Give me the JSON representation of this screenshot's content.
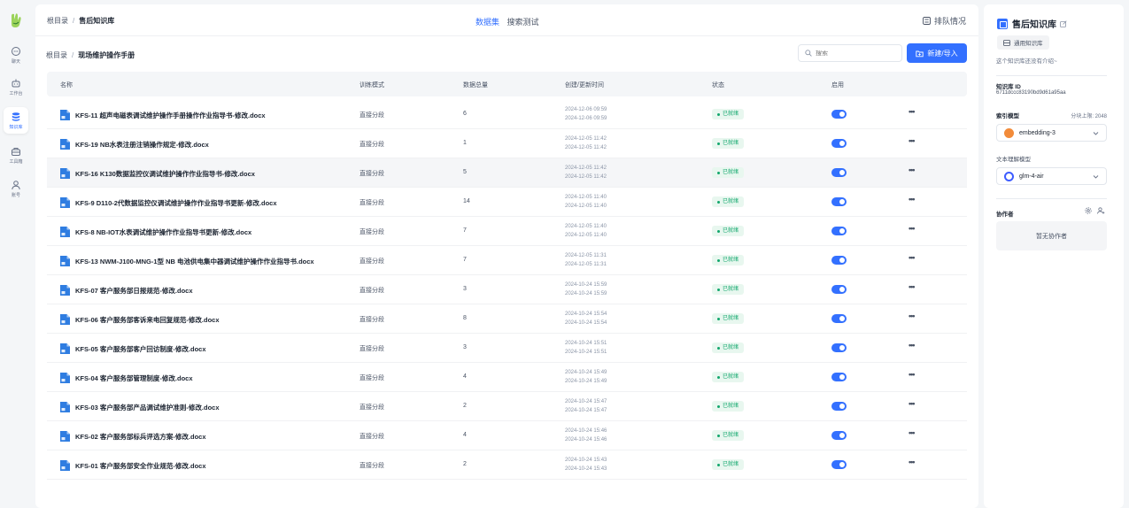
{
  "nav": {
    "items": [
      {
        "label": "聊天",
        "icon": "chat-icon"
      },
      {
        "label": "工作台",
        "icon": "robot-icon"
      },
      {
        "label": "知识库",
        "icon": "database-icon"
      },
      {
        "label": "工具箱",
        "icon": "toolbox-icon"
      },
      {
        "label": "账号",
        "icon": "user-icon"
      }
    ]
  },
  "header": {
    "breadcrumb_root": "根目录",
    "breadcrumb_current": "售后知识库",
    "tabs": [
      "数据集",
      "搜索测试"
    ],
    "queue_label": "排队情况"
  },
  "toolbar": {
    "breadcrumb_root": "根目录",
    "breadcrumb_current": "现场维护操作手册",
    "search_placeholder": "搜索",
    "new_button_label": "新建/导入"
  },
  "table": {
    "columns": [
      "名称",
      "训练模式",
      "数据总量",
      "创建/更新时间",
      "状态",
      "启用"
    ],
    "rows": [
      {
        "name": "KFS-11 超声电磁表调试维护操作手册操作作业指导书-修改.docx",
        "mode": "直接分段",
        "total": "6",
        "created": "2024-12-06 09:59",
        "updated": "2024-12-06 09:59",
        "status": "已就绪"
      },
      {
        "name": "KFS-19 NB水表注册注销操作规定-修改.docx",
        "mode": "直接分段",
        "total": "1",
        "created": "2024-12-05 11:42",
        "updated": "2024-12-05 11:42",
        "status": "已就绪"
      },
      {
        "name": "KFS-16 K130数据监控仪调试维护操作作业指导书-修改.docx",
        "mode": "直接分段",
        "total": "5",
        "created": "2024-12-05 11:42",
        "updated": "2024-12-05 11:42",
        "status": "已就绪"
      },
      {
        "name": "KFS-9 D110-2代数据监控仪调试维护操作作业指导书更新-修改.docx",
        "mode": "直接分段",
        "total": "14",
        "created": "2024-12-05 11:40",
        "updated": "2024-12-05 11:40",
        "status": "已就绪"
      },
      {
        "name": "KFS-8 NB-IOT水表调试维护操作作业指导书更新-修改.docx",
        "mode": "直接分段",
        "total": "7",
        "created": "2024-12-05 11:40",
        "updated": "2024-12-05 11:40",
        "status": "已就绪"
      },
      {
        "name": "KFS-13 NWM-J100-MNG-1型 NB 电池供电集中器调试维护操作作业指导书.docx",
        "mode": "直接分段",
        "total": "7",
        "created": "2024-12-05 11:31",
        "updated": "2024-12-05 11:31",
        "status": "已就绪"
      },
      {
        "name": "KFS-07 客户服务部日报规范-修改.docx",
        "mode": "直接分段",
        "total": "3",
        "created": "2024-10-24 15:59",
        "updated": "2024-10-24 15:59",
        "status": "已就绪"
      },
      {
        "name": "KFS-06 客户服务部客诉来电回复规范-修改.docx",
        "mode": "直接分段",
        "total": "8",
        "created": "2024-10-24 15:54",
        "updated": "2024-10-24 15:54",
        "status": "已就绪"
      },
      {
        "name": "KFS-05 客户服务部客户回访制度-修改.docx",
        "mode": "直接分段",
        "total": "3",
        "created": "2024-10-24 15:51",
        "updated": "2024-10-24 15:51",
        "status": "已就绪"
      },
      {
        "name": "KFS-04 客户服务部管理制度-修改.docx",
        "mode": "直接分段",
        "total": "4",
        "created": "2024-10-24 15:49",
        "updated": "2024-10-24 15:49",
        "status": "已就绪"
      },
      {
        "name": "KFS-03 客户服务部产品调试维护准则-修改.docx",
        "mode": "直接分段",
        "total": "2",
        "created": "2024-10-24 15:47",
        "updated": "2024-10-24 15:47",
        "status": "已就绪"
      },
      {
        "name": "KFS-02 客户服务部标兵评选方案-修改.docx",
        "mode": "直接分段",
        "total": "4",
        "created": "2024-10-24 15:46",
        "updated": "2024-10-24 15:46",
        "status": "已就绪"
      },
      {
        "name": "KFS-01 客户服务部安全作业规范-修改.docx",
        "mode": "直接分段",
        "total": "2",
        "created": "2024-10-24 15:43",
        "updated": "2024-10-24 15:43",
        "status": "已就绪"
      }
    ]
  },
  "side": {
    "title": "售后知识库",
    "type_chip": "通用知识库",
    "intro": "这个知识库还没有介绍~",
    "kb_id_label": "知识库 ID",
    "kb_id_value": "6711dccc83190bd9d61a95aa",
    "index_model_label": "索引模型",
    "chunk_limit": "分块上限: 2048",
    "index_model_value": "embedding-3",
    "text_model_label": "文本理解模型",
    "text_model_value": "glm-4-air",
    "collab_label": "协作者",
    "collab_empty": "暂无协作者"
  },
  "colors": {
    "accent": "#3370ff",
    "status_green": "#12a76d"
  }
}
